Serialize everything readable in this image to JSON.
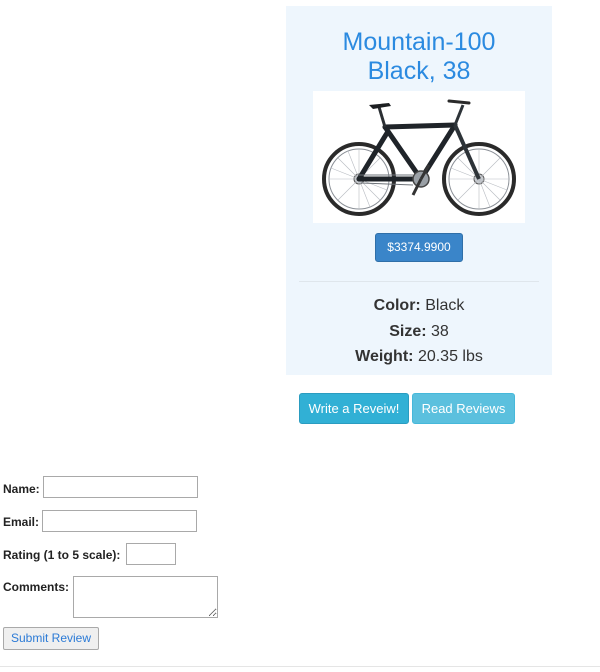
{
  "product": {
    "title_line1": "Mountain-100",
    "title_line2": "Black, 38",
    "image_icon": "mountain-bike-image",
    "price": "$3374.9900",
    "specs": {
      "color_label": "Color:",
      "color_value": "Black",
      "size_label": "Size:",
      "size_value": "38",
      "weight_label": "Weight:",
      "weight_value": "20.35 lbs"
    }
  },
  "actions": {
    "write_review": "Write a Reveiw!",
    "read_reviews": "Read Reviews"
  },
  "review_form": {
    "name_label": "Name:",
    "name_value": "",
    "email_label": "Email:",
    "email_value": "",
    "rating_label": "Rating (1 to 5 scale):",
    "rating_value": "",
    "comments_label": "Comments:",
    "comments_value": "",
    "submit_label": "Submit Review"
  },
  "colors": {
    "card_background": "#eef6fd",
    "title": "#2b8ae0",
    "price_button": "#3a85c9",
    "write_button": "#31b0d5",
    "read_button": "#5bc0de",
    "submit_text": "#2b7ad6"
  }
}
